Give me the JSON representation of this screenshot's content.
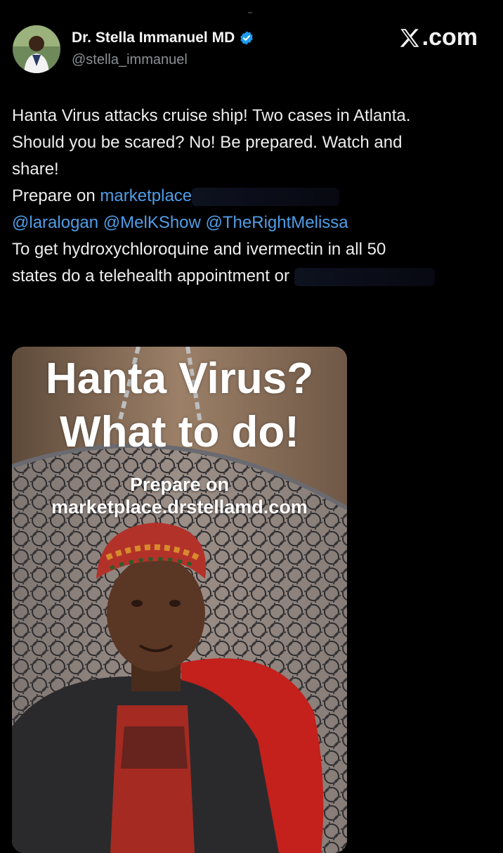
{
  "author": {
    "name": "Dr. Stella Immanuel MD",
    "handle": "@stella_immanuel",
    "verified": true,
    "avatar_icon": "profile-photo"
  },
  "brand": {
    "label": ".com",
    "logo_icon": "x-logo-icon"
  },
  "tweet": {
    "line1": "Hanta Virus attacks cruise ship! Two cases in Atlanta.",
    "line2": "Should you be scared? No! Be prepared. Watch and",
    "line3": "share!",
    "line4_prefix": "Prepare on ",
    "line4_link": "marketplace",
    "mentions": [
      "@laralogan",
      "@MelKShow",
      "@TheRightMelissa"
    ],
    "line6": "To get hydroxychloroquine and ivermectin in all 50",
    "line7": "states do a telehealth appointment or"
  },
  "video": {
    "title_line1": "Hanta Virus?",
    "title_line2": "What to do!",
    "subtitle_line1": "Prepare on",
    "subtitle_line2": "marketplace.drstellamd.com"
  },
  "colors": {
    "background": "#000000",
    "text": "#e7e9ea",
    "link": "#4f9ee8",
    "verified": "#1d9bf0",
    "handle": "#8b8f94"
  }
}
